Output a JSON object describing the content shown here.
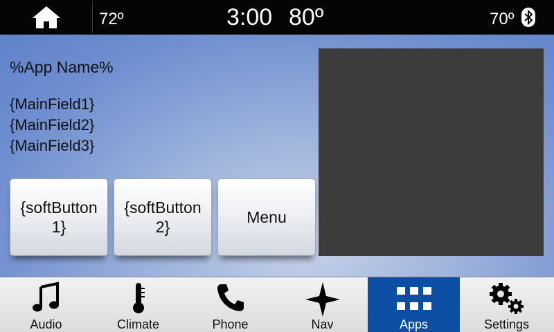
{
  "status_bar": {
    "outside_temp": "72º",
    "time": "3:00",
    "cabin_temp_left": "80º",
    "cabin_temp_right": "70º",
    "home_icon": "home-icon",
    "bluetooth_icon": "bluetooth-icon"
  },
  "main": {
    "app_name": "%App Name%",
    "fields": [
      "{MainField1}",
      "{MainField2}",
      "{MainField3}"
    ],
    "soft_buttons": [
      "{softButton1}",
      "{softButton2}",
      "Menu"
    ]
  },
  "nav": {
    "items": [
      {
        "label": "Audio",
        "icon": "music-note-icon"
      },
      {
        "label": "Climate",
        "icon": "thermometer-icon"
      },
      {
        "label": "Phone",
        "icon": "phone-icon"
      },
      {
        "label": "Nav",
        "icon": "compass-star-icon"
      },
      {
        "label": "Apps",
        "icon": "grid-icon",
        "active": true
      },
      {
        "label": "Settings",
        "icon": "gears-icon"
      }
    ],
    "active_color": "#0a4fa3"
  }
}
